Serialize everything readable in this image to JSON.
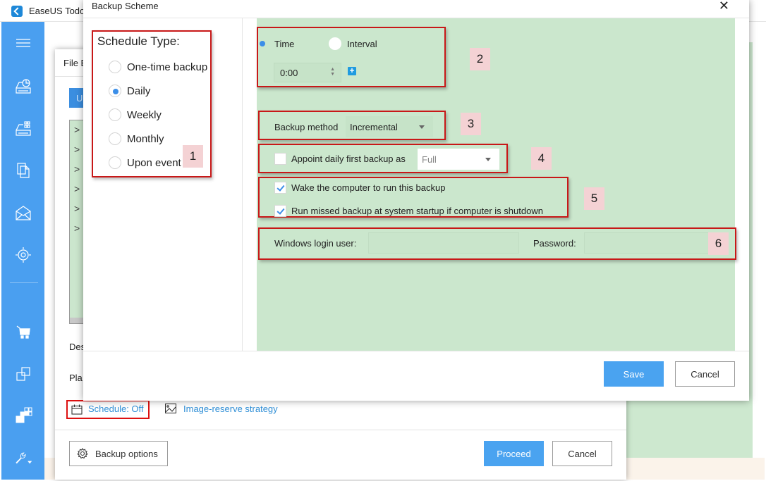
{
  "app": {
    "title": "EaseUS Todo",
    "sidebar": {
      "icons": [
        "menu-icon",
        "disk-backup-icon",
        "system-backup-icon",
        "file-backup-icon",
        "mail-backup-icon",
        "smart-backup-icon",
        "cart-icon",
        "clone-icon",
        "tools-grid-icon",
        "wrench-icon"
      ]
    }
  },
  "file_dialog": {
    "title": "File B",
    "blue_button": "U",
    "tree_items": [
      ">",
      ">",
      ">",
      ">",
      ">",
      ">"
    ],
    "destination_label": "Des",
    "plan_label": "Pla",
    "schedule_link": "Schedule: Off",
    "image_reserve_link": "Image-reserve strategy",
    "backup_options_label": "Backup options",
    "proceed_label": "Proceed",
    "cancel_label": "Cancel"
  },
  "scheme": {
    "title": "Backup Scheme",
    "close_glyph": "✕",
    "schedule_type": {
      "title": "Schedule Type:",
      "options": [
        {
          "label": "One-time backup",
          "selected": false
        },
        {
          "label": "Daily",
          "selected": true
        },
        {
          "label": "Weekly",
          "selected": false
        },
        {
          "label": "Monthly",
          "selected": false
        },
        {
          "label": "Upon event",
          "selected": false
        }
      ]
    },
    "time_mode": {
      "time_label": "Time",
      "interval_label": "Interval",
      "selected": "Time",
      "time_value": "0:00",
      "add_glyph": "+"
    },
    "backup_method": {
      "label": "Backup method",
      "value": "Incremental"
    },
    "appoint": {
      "label": "Appoint daily first backup as",
      "checked": false,
      "value": "Full"
    },
    "wake": {
      "label": "Wake the computer to run this backup",
      "checked": true
    },
    "run_missed": {
      "label": "Run missed backup at system startup if computer is shutdown",
      "checked": true
    },
    "login": {
      "user_label": "Windows login user:",
      "user_value": "",
      "password_label": "Password:",
      "password_value": ""
    },
    "save_label": "Save",
    "cancel_label": "Cancel"
  },
  "annotations": {
    "numbers": [
      "1",
      "2",
      "3",
      "4",
      "5",
      "6"
    ],
    "highlight_color": "#c81818",
    "label_bg": "#f4d2d4"
  },
  "colors": {
    "sidebar": "#4a9ff0",
    "accent": "#4aa3f0",
    "link": "#2e8ed6",
    "panel_green": "#cbe7cd"
  }
}
